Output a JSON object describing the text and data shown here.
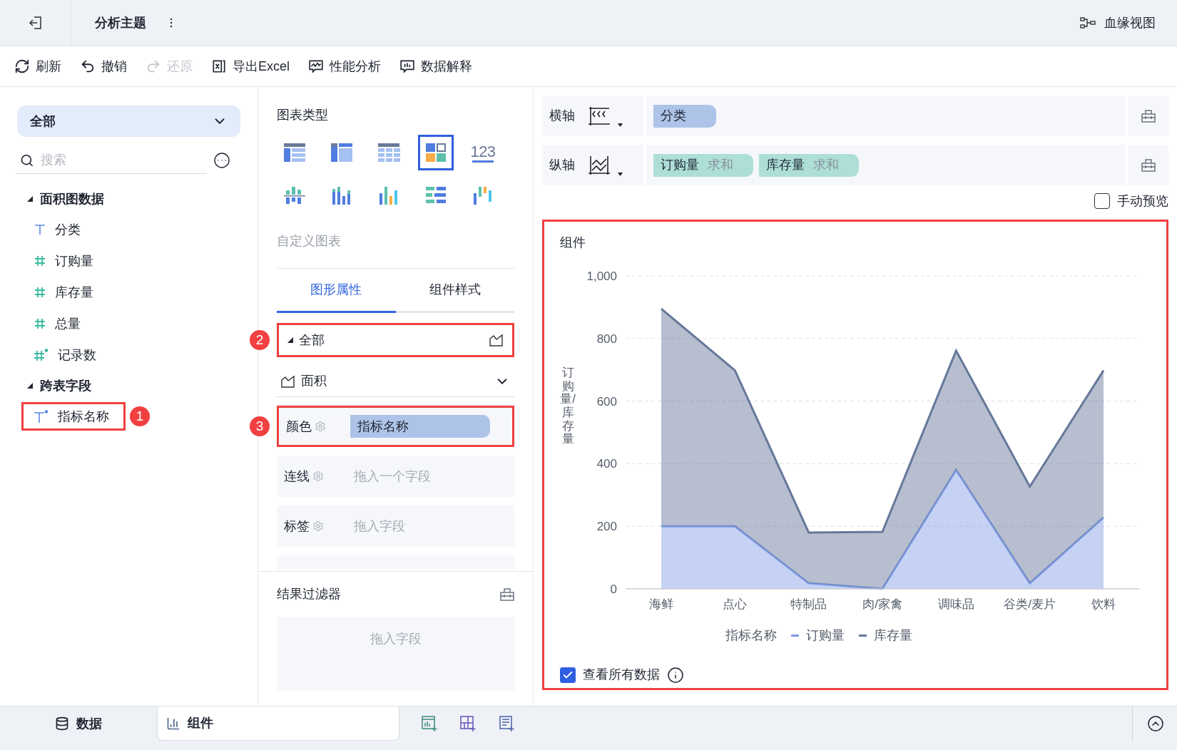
{
  "topbar": {
    "title": "分析主题",
    "lineage": "血缘视图"
  },
  "toolbar": [
    {
      "label": "刷新",
      "kind": "refresh",
      "disabled": false
    },
    {
      "label": "撤销",
      "kind": "undo",
      "disabled": false
    },
    {
      "label": "还原",
      "kind": "redo",
      "disabled": true
    },
    {
      "label": "导出Excel",
      "kind": "excel",
      "disabled": false
    },
    {
      "label": "性能分析",
      "kind": "perf",
      "disabled": false
    },
    {
      "label": "数据解释",
      "kind": "explain",
      "disabled": false
    }
  ],
  "left": {
    "dataset_select": "全部",
    "search_placeholder": "搜索",
    "groups": [
      {
        "label": "面积图数据",
        "expanded": true,
        "children": [
          {
            "label": "分类",
            "kind": "text",
            "highlighted": false
          },
          {
            "label": "订购量",
            "kind": "number",
            "highlighted": false
          },
          {
            "label": "库存量",
            "kind": "number",
            "highlighted": false
          },
          {
            "label": "总量",
            "kind": "number",
            "highlighted": false
          },
          {
            "label": "记录数",
            "kind": "number_calc",
            "highlighted": false
          }
        ]
      },
      {
        "label": "跨表字段",
        "expanded": true,
        "children": [
          {
            "label": "指标名称",
            "kind": "text_calc",
            "highlighted": true,
            "callout": "1"
          }
        ]
      }
    ]
  },
  "chart_types": {
    "title": "图表类型",
    "items": [
      {
        "kind": "table",
        "selected": false
      },
      {
        "kind": "cross_table",
        "selected": false
      },
      {
        "kind": "detail_table",
        "selected": false
      },
      {
        "kind": "dashboard",
        "selected": true
      },
      {
        "kind": "kpi",
        "label": "123",
        "selected": false
      },
      {
        "kind": "grouped_bar",
        "selected": false
      },
      {
        "kind": "stacked_bar",
        "selected": false
      },
      {
        "kind": "bar",
        "selected": false
      },
      {
        "kind": "bar_h",
        "selected": false
      },
      {
        "kind": "waterfall",
        "selected": false
      }
    ],
    "custom": "自定义图表"
  },
  "property_tabs": [
    {
      "label": "图形属性",
      "selected": true
    },
    {
      "label": "组件样式",
      "selected": false
    }
  ],
  "series_header": {
    "label": "全部",
    "expanded": true,
    "highlighted": true,
    "callout": "2"
  },
  "mark_type": "面积",
  "encodings": [
    {
      "label": "颜色",
      "value": "指标名称",
      "highlighted": true,
      "callout": "3"
    },
    {
      "label": "连线",
      "placeholder": "拖入一个字段",
      "highlighted": false
    },
    {
      "label": "标签",
      "placeholder": "拖入字段",
      "highlighted": false
    }
  ],
  "result_filter": {
    "title": "结果过滤器",
    "placeholder": "拖入字段"
  },
  "axes": [
    {
      "label": "横轴",
      "kind": "x",
      "fields": [
        {
          "name": "分类",
          "color": "#adc4e8"
        }
      ]
    },
    {
      "label": "纵轴",
      "kind": "y",
      "fields": [
        {
          "name": "订购量",
          "agg": "求和",
          "color": "#addfd8"
        },
        {
          "name": "库存量",
          "agg": "求和",
          "color": "#addfd8"
        }
      ]
    }
  ],
  "manual_preview": {
    "label": "手动预览",
    "checked": false
  },
  "widget": {
    "title": "组件",
    "highlighted": true,
    "legend_title": "指标名称",
    "show_all": {
      "label": "查看所有数据",
      "checked": true
    },
    "chart_data": {
      "type": "area",
      "ylabel": "订购量/库存量",
      "stacked": true,
      "categories": [
        "海鲜",
        "点心",
        "特制品",
        "肉/家禽",
        "调味品",
        "谷类/麦片",
        "饮料"
      ],
      "series": [
        {
          "name": "订购量",
          "color": "#7e9be6",
          "values": [
            200,
            200,
            18,
            0,
            380,
            18,
            228
          ]
        },
        {
          "name": "库存量",
          "color": "#66789a",
          "values": [
            695,
            498,
            162,
            182,
            381,
            309,
            470
          ]
        }
      ],
      "grid": true,
      "ylim": [
        0,
        1000
      ],
      "yticks": [
        0,
        200,
        400,
        600,
        800,
        {
          "value": 1000,
          "label": "1,000"
        }
      ]
    }
  },
  "bottom_tabs": [
    {
      "label": "数据",
      "kind": "data",
      "selected": false
    },
    {
      "label": "组件",
      "kind": "widget",
      "selected": true
    }
  ]
}
